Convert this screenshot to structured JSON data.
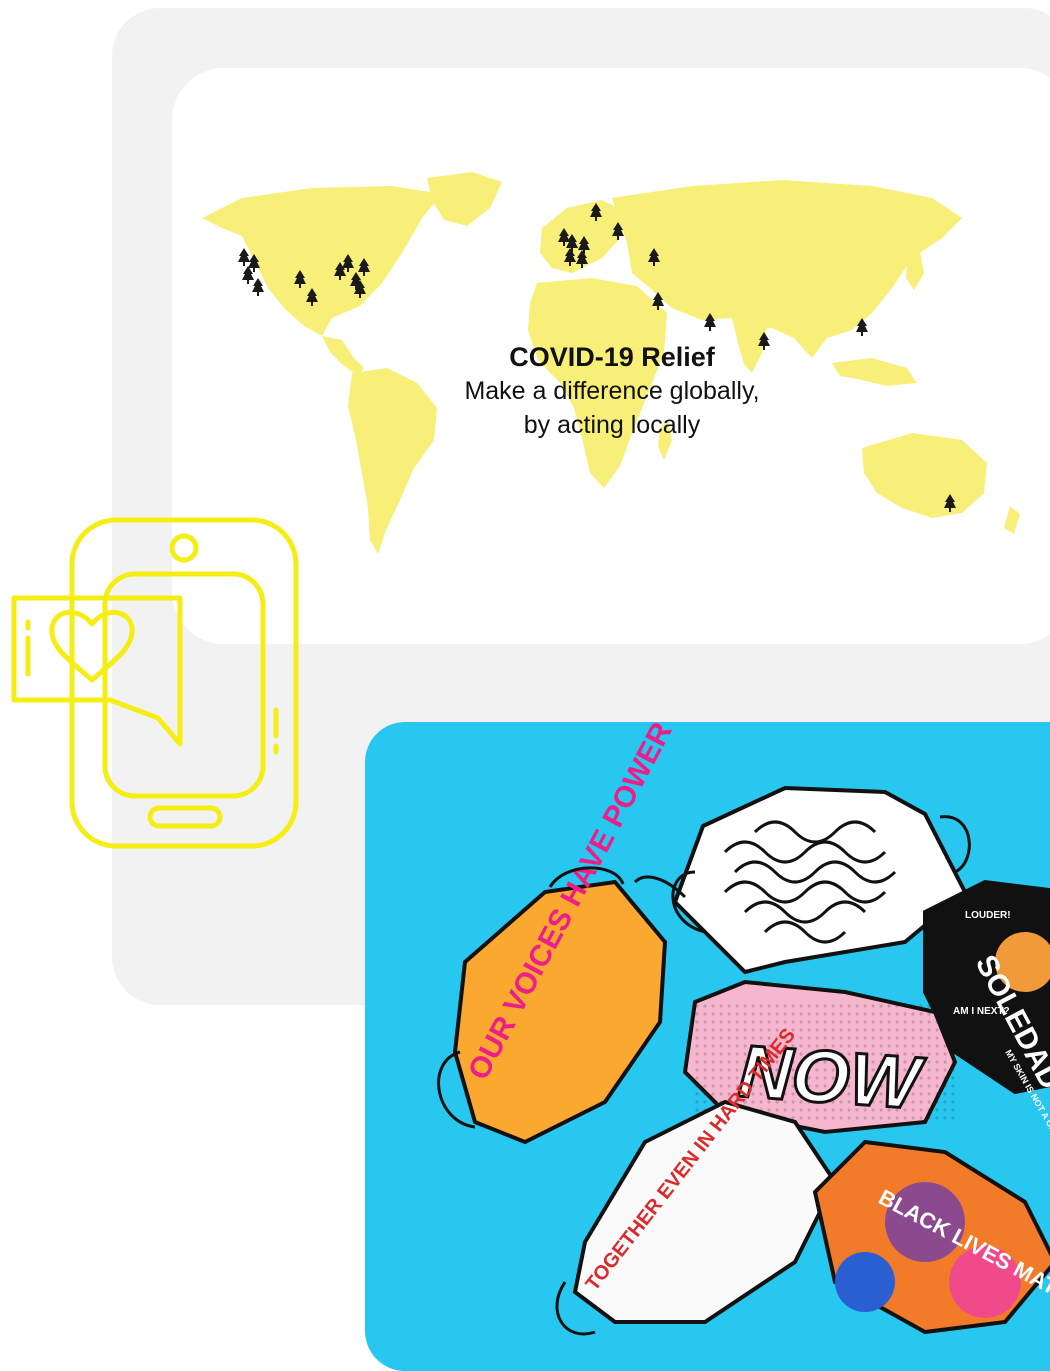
{
  "relief": {
    "title": "COVID-19 Relief",
    "subtitle_line1": "Make a difference globally,",
    "subtitle_line2": "by acting locally"
  },
  "icons": {
    "pin": "tree-pin-icon",
    "phone": "phone-heart-message-icon"
  },
  "masks": {
    "mask1": "OUR VOICES HAVE POWER",
    "mask2": "NOW",
    "mask3": "SOLEDAD",
    "mask4": "TOGETHER EVEN IN HARD TIMES",
    "mask5": "BLACK LIVES MATTER",
    "mask6_small1": "LOUDER!",
    "mask6_small2": "AM I NEXT?",
    "mask6_small3": "MY SKIN IS NOT A CRIME!"
  },
  "colors": {
    "map_land": "#f8ef78",
    "accent_yellow": "#f5ee14",
    "photo_bg": "#28c7ef",
    "panel_bg": "#f2f2f2"
  }
}
